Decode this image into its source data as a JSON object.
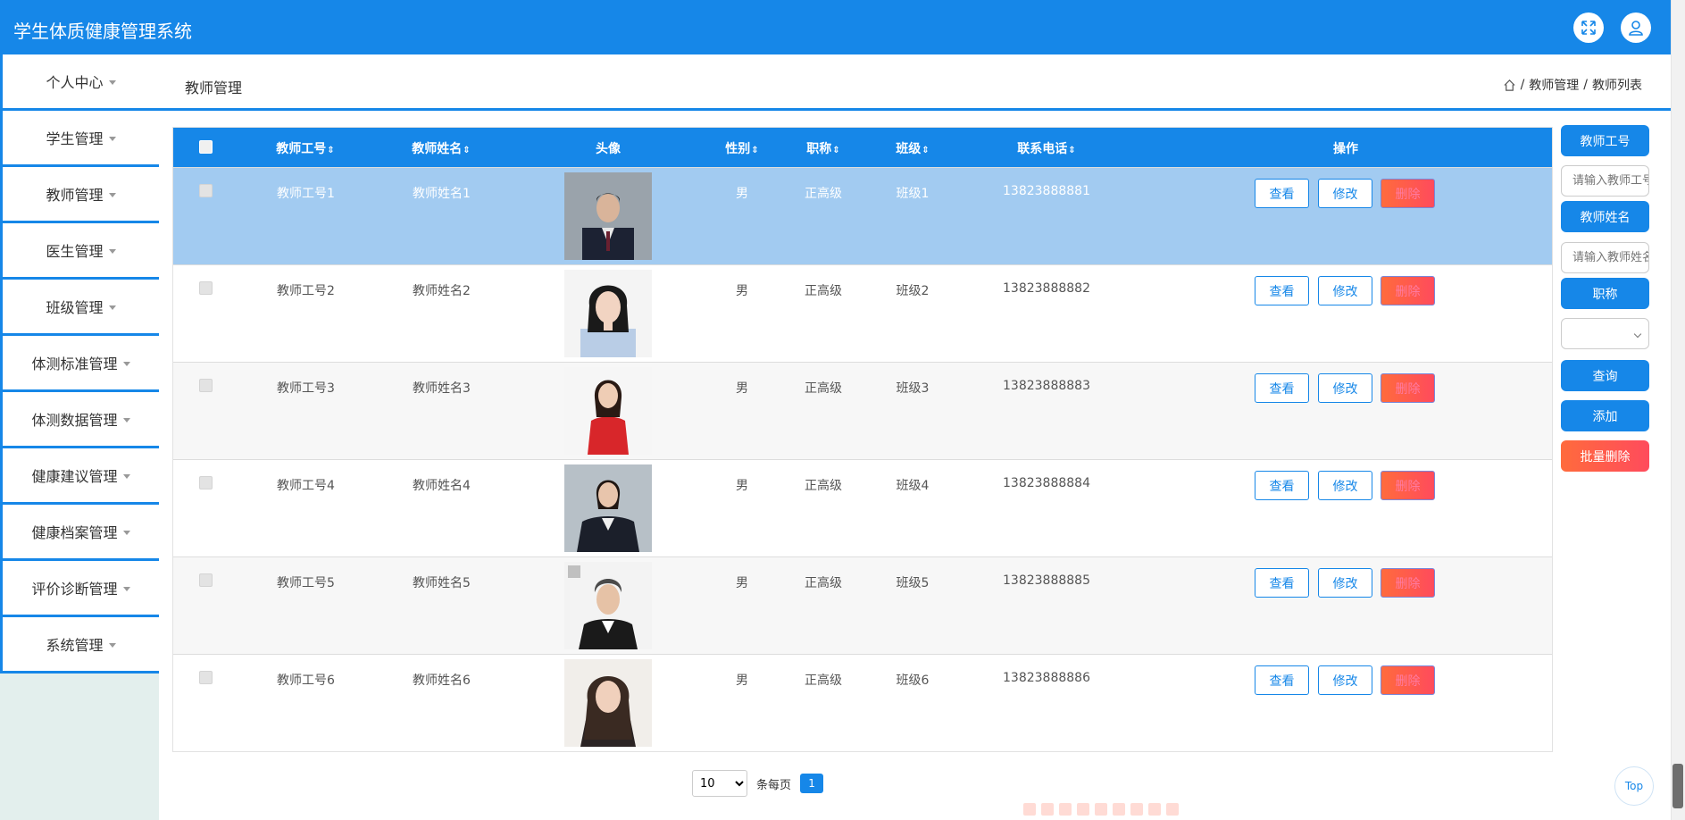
{
  "app": {
    "title": "学生体质健康管理系统"
  },
  "sidebar": {
    "items": [
      {
        "label": "个人中心"
      },
      {
        "label": "学生管理"
      },
      {
        "label": "教师管理"
      },
      {
        "label": "医生管理"
      },
      {
        "label": "班级管理"
      },
      {
        "label": "体测标准管理"
      },
      {
        "label": "体测数据管理"
      },
      {
        "label": "健康建议管理"
      },
      {
        "label": "健康档案管理"
      },
      {
        "label": "评价诊断管理"
      },
      {
        "label": "系统管理"
      }
    ]
  },
  "header": {
    "page_title": "教师管理",
    "breadcrumb": {
      "sep": "/",
      "level1": "教师管理",
      "level2": "教师列表"
    }
  },
  "table": {
    "columns": {
      "teacher_no": "教师工号",
      "teacher_name": "教师姓名",
      "avatar": "头像",
      "gender": "性别",
      "title": "职称",
      "class": "班级",
      "phone": "联系电话",
      "actions": "操作"
    },
    "sort_icon": "⇕",
    "rows": [
      {
        "no": "教师工号1",
        "name": "教师姓名1",
        "gender": "男",
        "title": "正高级",
        "class": "班级1",
        "phone": "13823888881"
      },
      {
        "no": "教师工号2",
        "name": "教师姓名2",
        "gender": "男",
        "title": "正高级",
        "class": "班级2",
        "phone": "13823888882"
      },
      {
        "no": "教师工号3",
        "name": "教师姓名3",
        "gender": "男",
        "title": "正高级",
        "class": "班级3",
        "phone": "13823888883"
      },
      {
        "no": "教师工号4",
        "name": "教师姓名4",
        "gender": "男",
        "title": "正高级",
        "class": "班级4",
        "phone": "13823888884"
      },
      {
        "no": "教师工号5",
        "name": "教师姓名5",
        "gender": "男",
        "title": "正高级",
        "class": "班级5",
        "phone": "13823888885"
      },
      {
        "no": "教师工号6",
        "name": "教师姓名6",
        "gender": "男",
        "title": "正高级",
        "class": "班级6",
        "phone": "13823888886"
      }
    ],
    "actions": {
      "view": "查看",
      "edit": "修改",
      "delete": "删除"
    }
  },
  "pagination": {
    "page_size": "10",
    "per_page_label": "条每页",
    "current_page": "1"
  },
  "search_panel": {
    "teacher_no_label": "教师工号",
    "teacher_no_placeholder": "请输入教师工号",
    "teacher_name_label": "教师姓名",
    "teacher_name_placeholder": "请输入教师姓名",
    "title_label": "职称",
    "query_button": "查询",
    "add_button": "添加",
    "batch_delete_button": "批量删除"
  },
  "back_to_top": "Top",
  "colors": {
    "primary": "#1687e8",
    "selected_row": "#a2cbf1",
    "danger": "#ff5a4a"
  }
}
